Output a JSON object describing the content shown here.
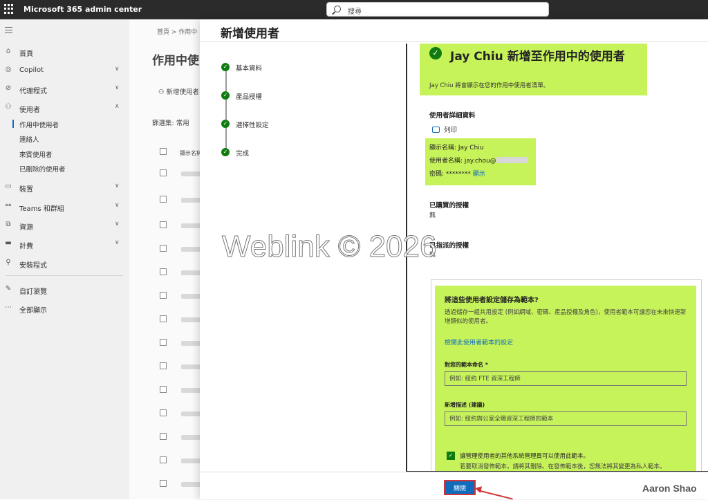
{
  "topbar": {
    "app_name": "Microsoft 365 admin center",
    "search_placeholder": "搜尋"
  },
  "nav": {
    "items": [
      {
        "label": "首頁",
        "icon": "home-icon"
      },
      {
        "label": "Copilot",
        "icon": "copilot-icon"
      },
      {
        "label": "代理程式",
        "icon": "agents-icon"
      },
      {
        "label": "使用者",
        "icon": "user-icon"
      },
      {
        "label": "裝置",
        "icon": "device-icon"
      },
      {
        "label": "Teams 和群組",
        "icon": "teams-icon"
      },
      {
        "label": "資源",
        "icon": "resources-icon"
      },
      {
        "label": "計費",
        "icon": "billing-icon"
      },
      {
        "label": "安裝程式",
        "icon": "setup-icon"
      },
      {
        "label": "自訂瀏覽",
        "icon": "pencil-icon"
      },
      {
        "label": "全部顯示",
        "icon": "more-icon"
      }
    ],
    "user_subitems": [
      "作用中使用者",
      "連絡人",
      "來賓使用者",
      "已刪除的使用者"
    ]
  },
  "background": {
    "breadcrumb": "首頁 > 作用中",
    "title": "作用中使",
    "add_user": "新增使用者",
    "filter": "篩選集: 常用",
    "column_header": "顯示名稱"
  },
  "panel": {
    "title": "新增使用者",
    "steps": [
      "基本資料",
      "產品授權",
      "選擇性設定",
      "完成"
    ],
    "success_title": "Jay Chiu 新增至作用中的使用者",
    "success_desc": "Jay Chiu 將會顯示在您的作用中使用者清單。",
    "details_heading": "使用者詳細資料",
    "print_label": "列印",
    "display_name": "顯示名稱: Jay Chiu",
    "user_name": "使用者名稱: jay.chou@",
    "password_label": "密碼: ********",
    "show_link": "顯示",
    "licenses_heading": "已購買的授權",
    "licenses_value": "無",
    "assigned_heading": "已指派的授權",
    "assigned_value": "無",
    "template": {
      "title": "將這些使用者設定儲存為範本?",
      "desc": "透過儲存一組共用設定 (例如網域、密碼、產品授權及角色)，使用者範本可讓您在未來快速新增類似的使用者。",
      "link": "檢閱此使用者範本的設定",
      "name_label": "對您的範本命名 *",
      "name_placeholder": "例如: 紐約 FTE 資深工程師",
      "desc_label": "新增描述 (建議)",
      "desc_placeholder": "例如: 紐約辦公室全職資深工程師的範本",
      "checkbox_label": "讓管理使用者的其他系統管理員可以使用此範本。",
      "note": "若要取消發佈範本，請將其刪除。在發佈範本後，您無法將其變更為私人範本。"
    },
    "close_button": "關閉"
  },
  "watermark": "Weblink © 2026",
  "author": "Aaron Shao",
  "colors": {
    "accent": "#0f6cbd",
    "success": "#107c10",
    "highlight": "#c6f25a",
    "annotation": "#d13438"
  }
}
